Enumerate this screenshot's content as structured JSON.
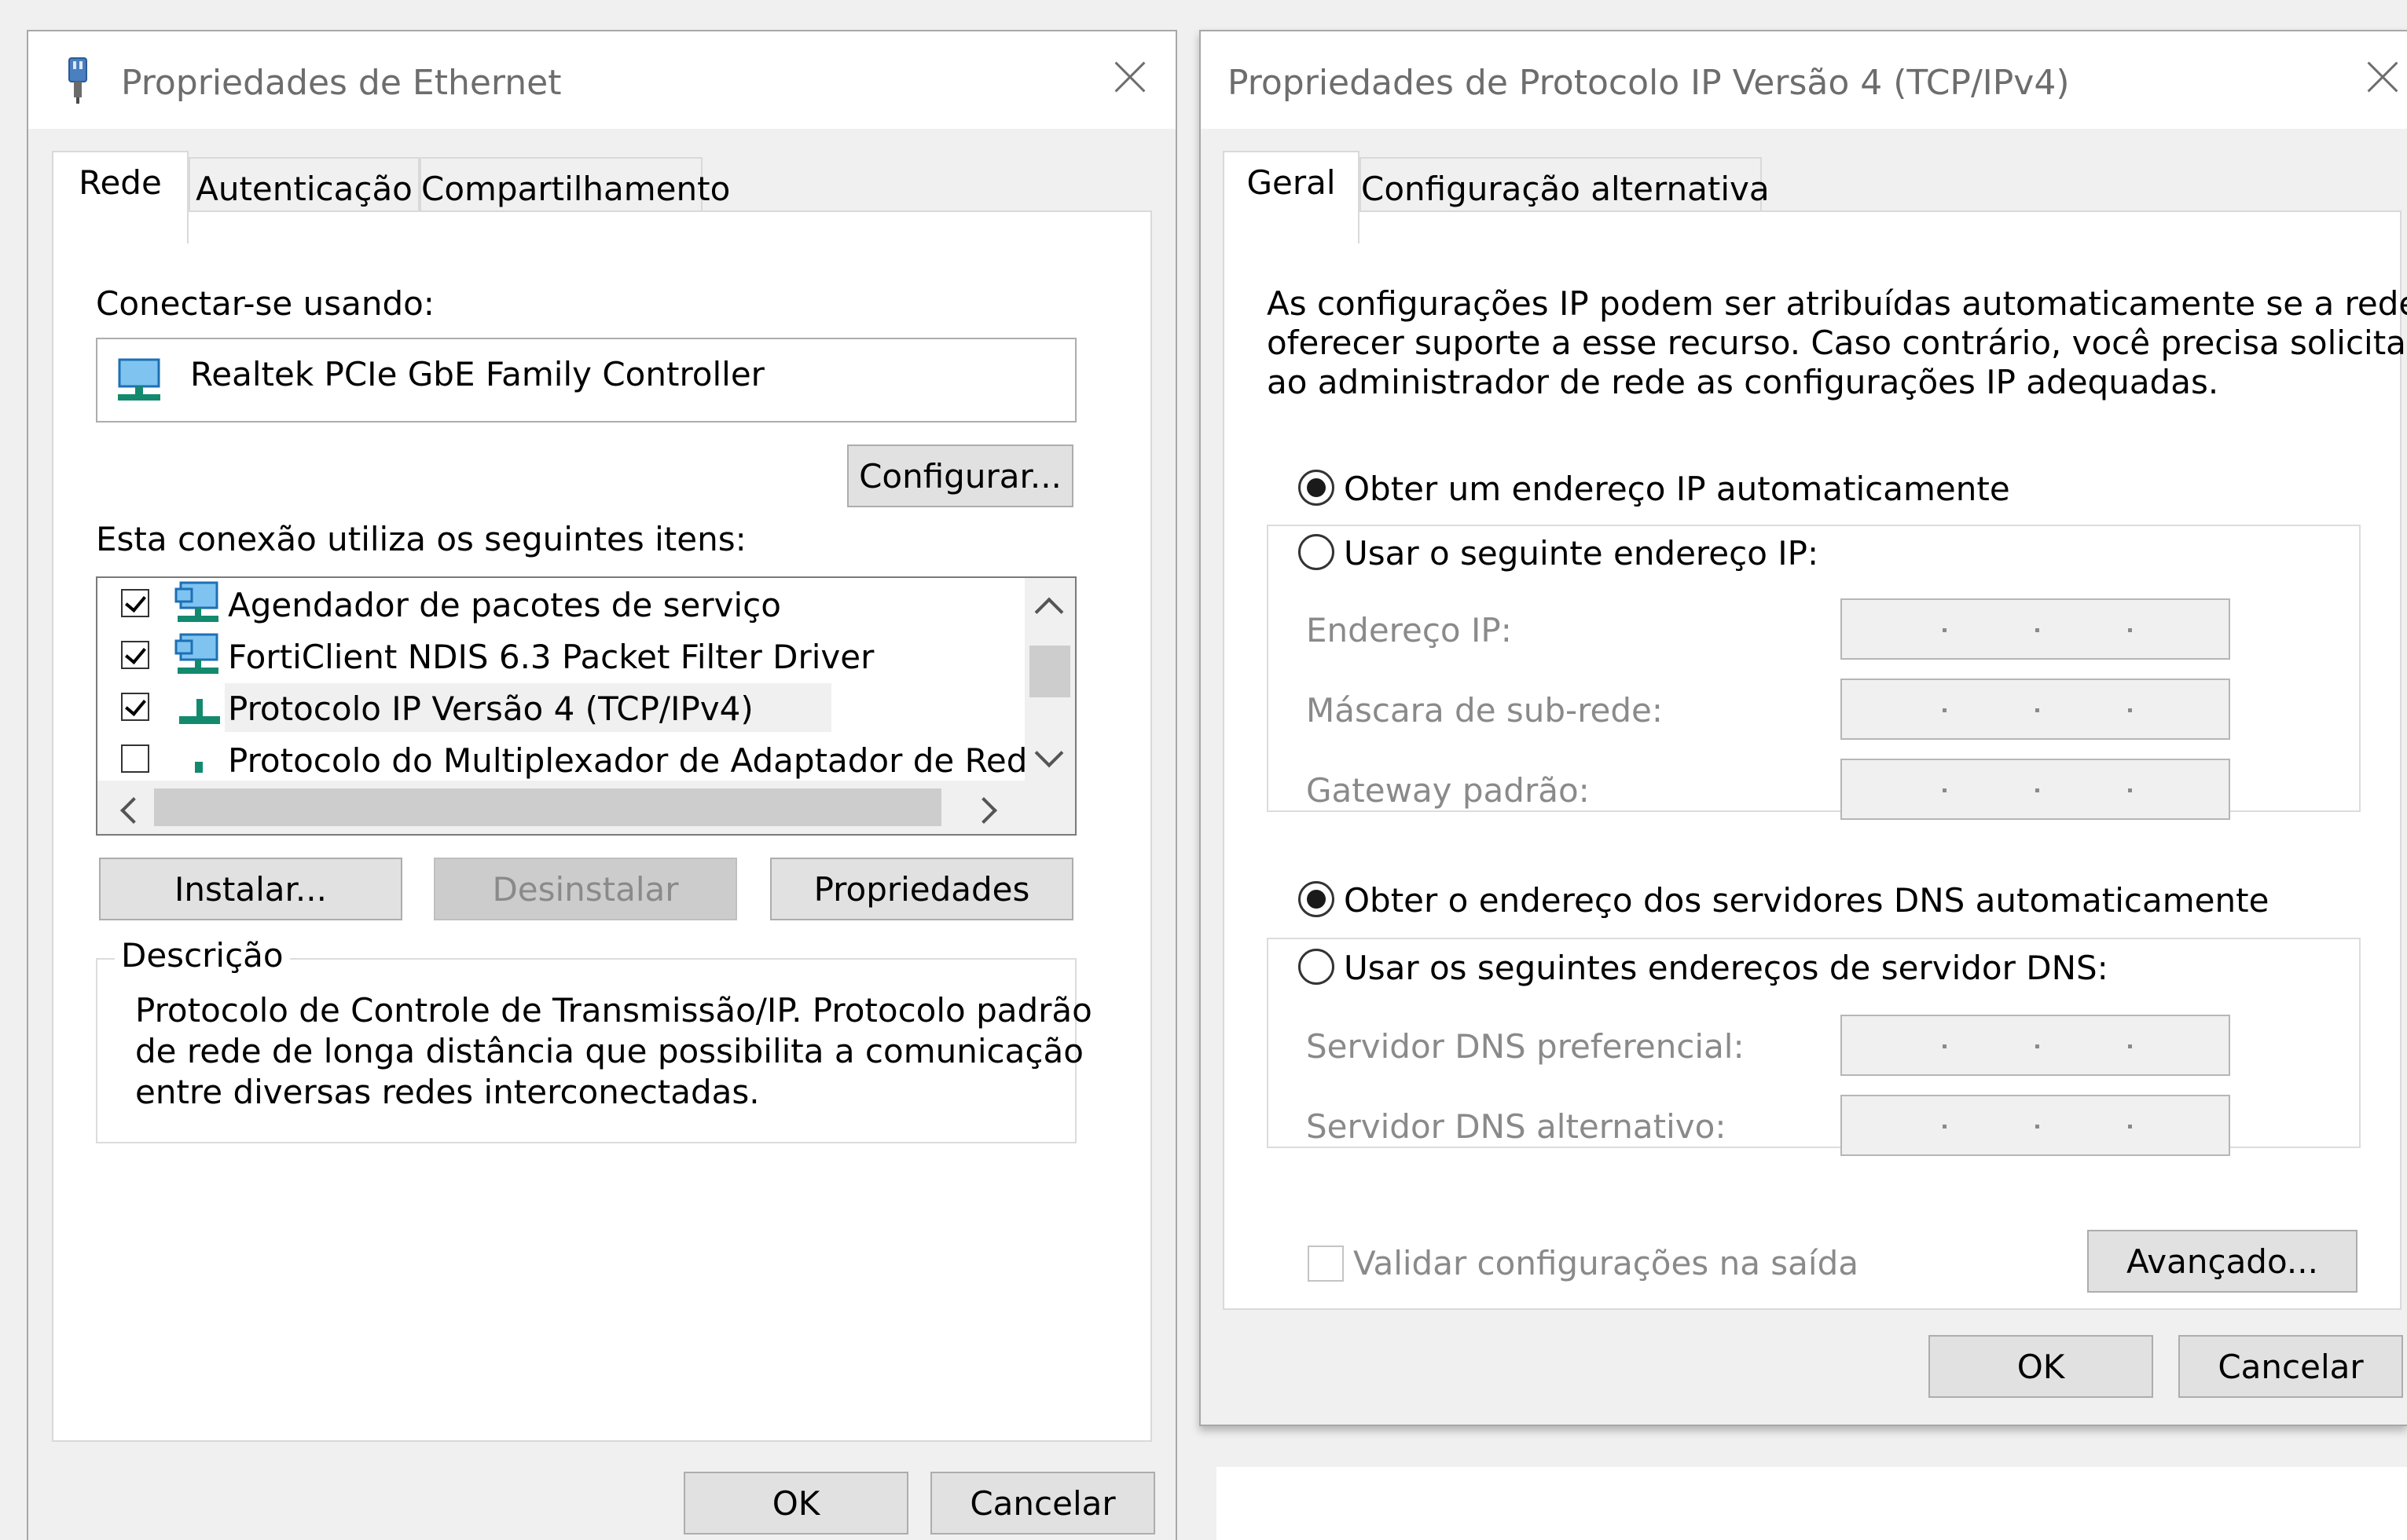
{
  "ethernet_window": {
    "title": "Propriedades de Ethernet",
    "tabs": [
      "Rede",
      "Autenticação",
      "Compartilhamento"
    ],
    "connect_using_label": "Conectar-se usando:",
    "adapter_name": "Realtek PCIe GbE Family Controller",
    "configure_button": "Configurar...",
    "items_label": "Esta conexão utiliza os seguintes itens:",
    "items": [
      {
        "label": "Agendador de pacotes de serviço",
        "checked": true
      },
      {
        "label": "FortiClient NDIS 6.3 Packet Filter Driver",
        "checked": true
      },
      {
        "label": "Protocolo IP Versão 4 (TCP/IPv4)",
        "checked": true
      },
      {
        "label": "Protocolo do Multiplexador de Adaptador de Rede da M",
        "checked": false
      }
    ],
    "buttons": {
      "install": "Instalar...",
      "uninstall": "Desinstalar",
      "properties": "Propriedades"
    },
    "description_legend": "Descrição",
    "description_lines": [
      "Protocolo de Controle de Transmissão/IP. Protocolo padrão",
      "de rede de longa distância que possibilita a comunicação",
      "entre diversas redes interconectadas."
    ],
    "ok": "OK",
    "cancel": "Cancelar"
  },
  "ipv4_window": {
    "title": "Propriedades de Protocolo IP Versão 4 (TCP/IPv4)",
    "tabs": [
      "Geral",
      "Configuração alternativa"
    ],
    "info_lines": [
      "As configurações IP podem ser atribuídas automaticamente se a rede",
      "oferecer suporte a esse recurso. Caso contrário, você precisa solicitar",
      "ao administrador de rede as configurações IP adequadas."
    ],
    "ip_auto": "Obter um endereço IP automaticamente",
    "ip_manual": "Usar o seguinte endereço IP:",
    "ip_address_label": "Endereço IP:",
    "subnet_label": "Máscara de sub-rede:",
    "gateway_label": "Gateway padrão:",
    "dns_auto": "Obter o endereço dos servidores DNS automaticamente",
    "dns_manual": "Usar os seguintes endereços de servidor DNS:",
    "dns_preferred_label": "Servidor DNS preferencial:",
    "dns_alternate_label": "Servidor DNS alternativo:",
    "validate_label": "Validar configurações na saída",
    "advanced_button": "Avançado...",
    "ok": "OK",
    "cancel": "Cancelar"
  },
  "colors": {
    "accent_icon": "#1e6fb5",
    "ip_stand": "#138a6e",
    "window_bg": "#f0f0f0"
  }
}
